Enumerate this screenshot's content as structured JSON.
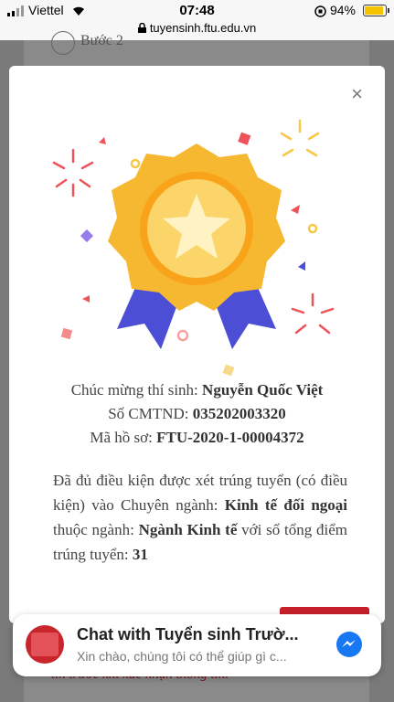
{
  "status_bar": {
    "carrier": "Viettel",
    "time": "07:48",
    "battery": "94%"
  },
  "url_bar": {
    "url": "tuyensinh.ftu.edu.vn"
  },
  "background": {
    "step_label": "Bước 2"
  },
  "modal": {
    "close": "×",
    "line1_prefix": "Chúc mừng thí sinh:",
    "line1_name": "Nguyễn Quốc Việt",
    "line2_prefix": "Số CMTND:",
    "line2_value": "035202003320",
    "line3_prefix": "Mã hồ sơ:",
    "line3_value": "FTU-2020-1-00004372",
    "desc_part1": "Đã đủ điều kiện được xét trúng tuyển (có điều kiện) vào Chuyên ngành:",
    "desc_major": "Kinh tế đối ngoại",
    "desc_part2": "thuộc ngành:",
    "desc_field": "Ngành Kinh tế",
    "desc_part3": "với số tổng điểm trúng tuyển:",
    "desc_score": "31"
  },
  "bottom_text": "tin trước khi xác nhận thông tin.",
  "chat": {
    "title": "Chat with Tuyển sinh Trườ...",
    "subtitle": "Xin chào, chúng tôi có thể giúp gì c..."
  },
  "colors": {
    "accent_red": "#c8202a",
    "medal_gold": "#f6b731",
    "ribbon_blue": "#4d4ed6"
  }
}
